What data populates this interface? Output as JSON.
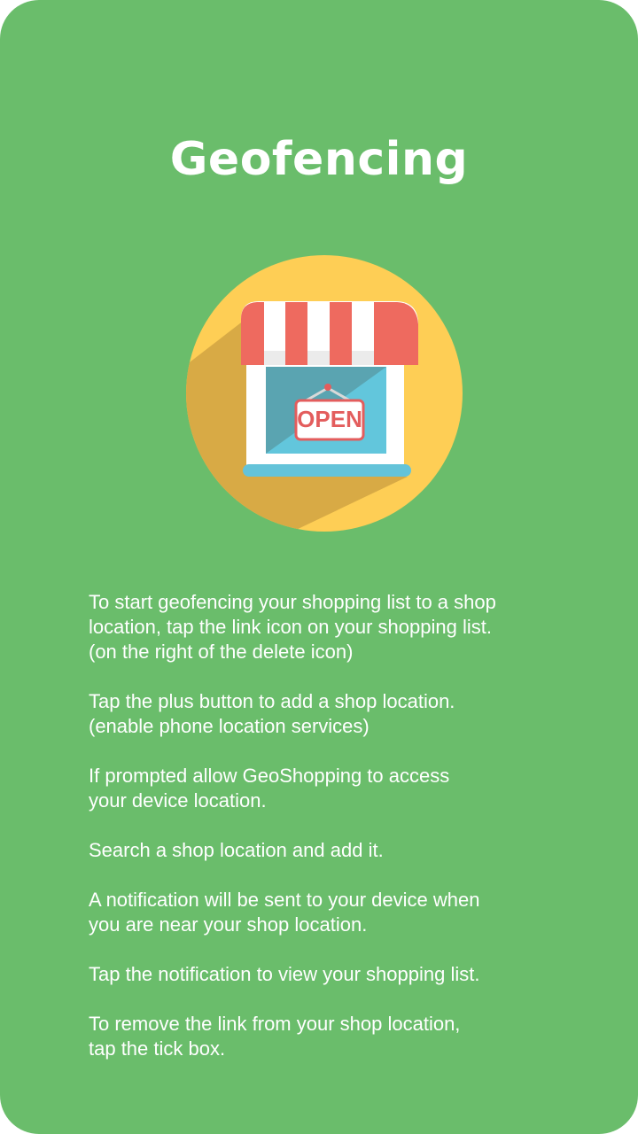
{
  "page": {
    "title": "Geofencing"
  },
  "illustration": {
    "icon": "shop-open-icon",
    "sign_text": "OPEN",
    "colors": {
      "circle": "#fece55",
      "shadow": "#d9a944",
      "awning_red": "#ee6a5f",
      "awning_white": "#ffffff",
      "window": "#62c6dc",
      "sign_text": "#e35d5d"
    }
  },
  "instructions": [
    {
      "text": "To start geofencing your shopping list to a shop\nlocation, tap the link icon on your shopping list.\n(on the right of the delete icon)"
    },
    {
      "text": "Tap the plus button to add a shop location.\n(enable phone location services)"
    },
    {
      "text": "If prompted allow GeoShopping to access\nyour device location."
    },
    {
      "text": "Search a shop location and add it."
    },
    {
      "text": "A notification will be sent to your device when\nyou are near your shop location."
    },
    {
      "text": "Tap the notification to view your shopping list."
    },
    {
      "text": "To remove the link from your shop location,\ntap the tick box."
    }
  ],
  "colors": {
    "background": "#6abd6b",
    "text": "#ffffff"
  }
}
